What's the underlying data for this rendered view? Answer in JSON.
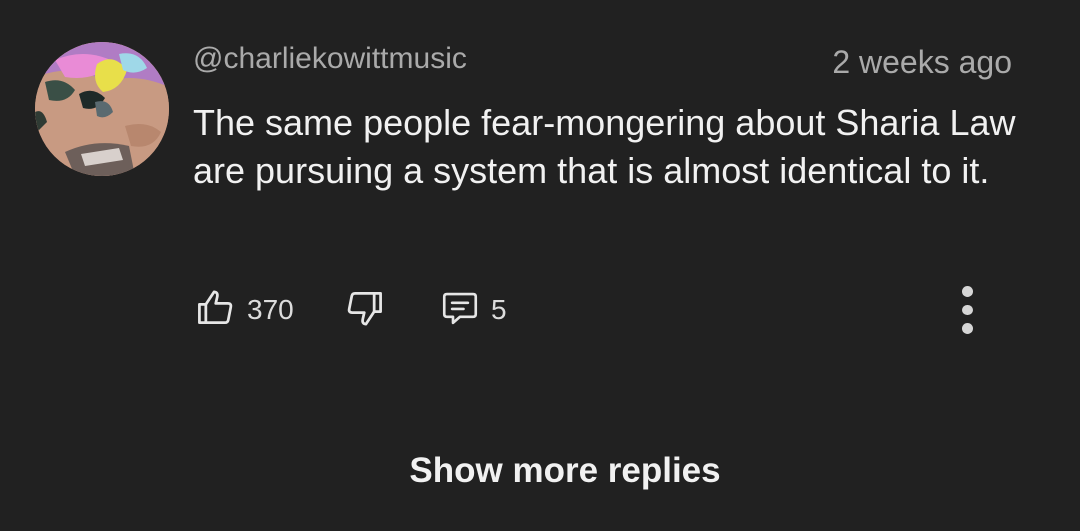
{
  "comment": {
    "author": "@charliekowittmusic",
    "timestamp": "2 weeks ago",
    "text": "The same people fear-mongering about Sharia Law are pursuing a system that is almost identical to it.",
    "like_count": "370",
    "reply_count": "5"
  },
  "icons": {
    "like": "thumbs-up-icon",
    "dislike": "thumbs-down-icon",
    "reply": "comment-bubble-icon",
    "more": "vertical-dots-icon"
  },
  "show_more_label": "Show more replies",
  "colors": {
    "background": "#212121",
    "primary_text": "#f1f1f1",
    "secondary_text": "#aaaaaa"
  }
}
